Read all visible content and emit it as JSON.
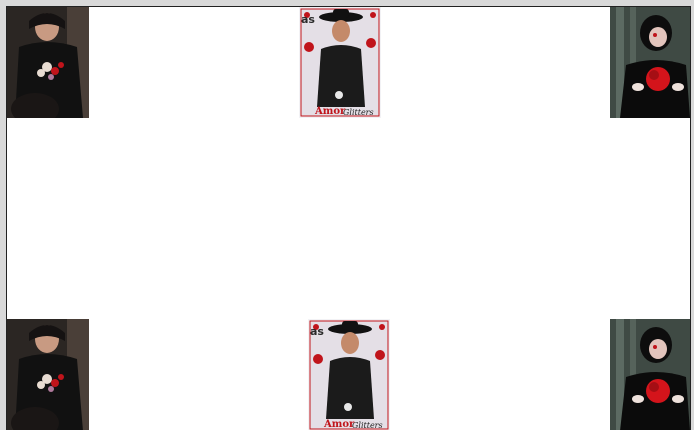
{
  "tiles": [
    {
      "subject": "person-in-black-hoodie-holding-roses"
    },
    {
      "subject": "man-in-cowboy-hat-black-shirt",
      "caption": "Amor",
      "caption2": "Glitters",
      "corner": "as"
    },
    {
      "subject": "person-in-black-holding-red-rose"
    },
    {
      "subject": "person-in-black-hoodie-holding-roses"
    },
    {
      "subject": "man-in-cowboy-hat-black-shirt",
      "caption": "Amor",
      "caption2": "Glitters",
      "corner": "as"
    },
    {
      "subject": "person-in-black-holding-red-rose"
    }
  ],
  "colors": {
    "frame": "#d9d9d9",
    "page": "#ffffff",
    "rose": "#c0141b"
  }
}
